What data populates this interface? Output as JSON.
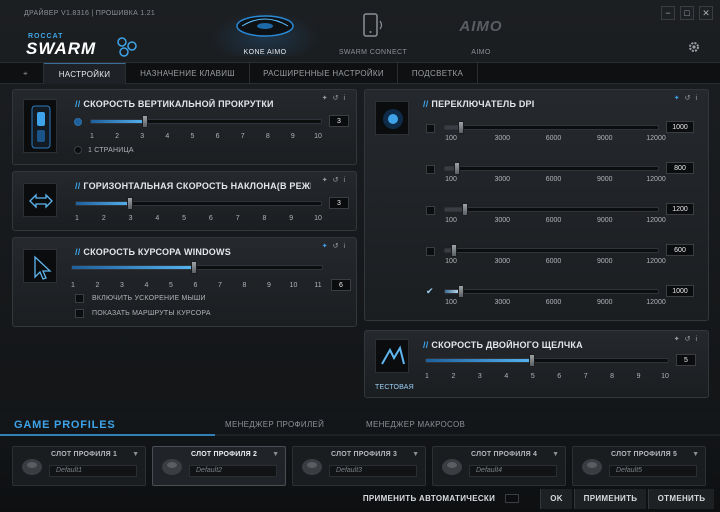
{
  "app": {
    "title": "ДРАЙВЕР V1.8316 | ПРОШИВКА 1.21",
    "logo_top": "ROCCAT",
    "logo_main": "SWARM"
  },
  "window_controls": {
    "minimize": "−",
    "maximize": "□",
    "close": "✕"
  },
  "devices": [
    {
      "label": "KONE AIMO",
      "active": true
    },
    {
      "label": "SWARM CONNECT",
      "active": false
    },
    {
      "label": "AIMO",
      "active": false
    }
  ],
  "tabs": [
    {
      "label": "НАСТРОЙКИ",
      "active": true
    },
    {
      "label": "НАЗНАЧЕНИЕ КЛАВИШ",
      "active": false
    },
    {
      "label": "РАСШИРЕННЫЕ НАСТРОЙКИ",
      "active": false
    },
    {
      "label": "ПОДСВЕТКА",
      "active": false
    }
  ],
  "vertical_scroll": {
    "title": "СКОРОСТЬ ВЕРТИКАЛЬНОЙ ПРОКРУТКИ",
    "ticks": [
      "1",
      "2",
      "3",
      "4",
      "5",
      "6",
      "7",
      "8",
      "9",
      "10"
    ],
    "value": "3",
    "page_option": "1 СТРАНИЦА"
  },
  "horizontal_tilt": {
    "title": "ГОРИЗОНТАЛЬНАЯ СКОРОСТЬ НАКЛОНА(В РЕЖИМЕ",
    "ticks": [
      "1",
      "2",
      "3",
      "4",
      "5",
      "6",
      "7",
      "8",
      "9",
      "10"
    ],
    "value": "3"
  },
  "cursor_speed": {
    "title": "СКОРОСТЬ КУРСОРА WINDOWS",
    "ticks": [
      "1",
      "2",
      "3",
      "4",
      "5",
      "6",
      "7",
      "8",
      "9",
      "10",
      "11"
    ],
    "value": "6",
    "accel_label": "ВКЛЮЧИТЬ УСКОРЕНИЕ МЫШИ",
    "trail_label": "ПОКАЗАТЬ МАРШРУТЫ КУРСОРА"
  },
  "dpi": {
    "title": "ПЕРЕКЛЮЧАТЕЛЬ DPI",
    "ticks": [
      "100",
      "3000",
      "6000",
      "9000",
      "12000"
    ],
    "levels": [
      {
        "value": "1000",
        "checked": false,
        "fill": 0.075
      },
      {
        "value": "800",
        "checked": false,
        "fill": 0.058
      },
      {
        "value": "1200",
        "checked": false,
        "fill": 0.092
      },
      {
        "value": "600",
        "checked": false,
        "fill": 0.042
      },
      {
        "value": "1000",
        "checked": true,
        "fill": 0.075
      }
    ]
  },
  "double_click": {
    "title": "СКОРОСТЬ ДВОЙНОГО ЩЕЛЧКА",
    "ticks": [
      "1",
      "2",
      "3",
      "4",
      "5",
      "6",
      "7",
      "8",
      "9",
      "10"
    ],
    "value": "5",
    "test_label": "ТЕСТОВАЯ"
  },
  "panel_icons": {
    "pin": "📌",
    "reset": "↺",
    "info": "i"
  },
  "game_profiles": {
    "title": "GAME PROFILES",
    "tab_manager": "МЕНЕДЖЕР ПРОФИЛЕЙ",
    "tab_macros": "МЕНЕДЖЕР МАКРОСОВ",
    "slots": [
      {
        "name": "СЛОТ ПРОФИЛЯ 1",
        "profile": "Default1",
        "active": false
      },
      {
        "name": "СЛОТ ПРОФИЛЯ 2",
        "profile": "Default2",
        "active": true
      },
      {
        "name": "СЛОТ ПРОФИЛЯ 3",
        "profile": "Default3",
        "active": false
      },
      {
        "name": "СЛОТ ПРОФИЛЯ 4",
        "profile": "Default4",
        "active": false
      },
      {
        "name": "СЛОТ ПРОФИЛЯ 5",
        "profile": "Default5",
        "active": false
      }
    ]
  },
  "footer": {
    "auto_apply": "ПРИМЕНИТЬ АВТОМАТИЧЕСКИ",
    "ok": "OK",
    "apply": "ПРИМЕНИТЬ",
    "cancel": "ОТМЕНИТЬ"
  },
  "colors": {
    "accent": "#3ea3e8",
    "panel": "#22252a",
    "background": "#141618"
  }
}
